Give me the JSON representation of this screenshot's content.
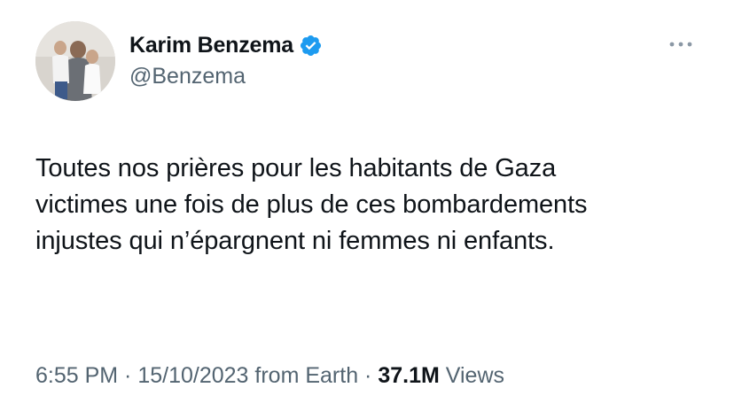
{
  "author": {
    "display_name": "Karim Benzema",
    "handle": "@Benzema",
    "verified": true,
    "avatar": "profile-photo"
  },
  "tweet": {
    "lines": [
      "Toutes nos prières pour les habitants de Gaza",
      "victimes une fois de plus de ces bombardements",
      "injustes qui n’épargnent ni femmes ni enfants."
    ]
  },
  "meta": {
    "time": "6:55 PM",
    "sep1": " · ",
    "date": "15/10/2023",
    "source": " from Earth",
    "sep2": " · ",
    "views_count": "37.1M",
    "views_label": " Views"
  },
  "icons": {
    "verified": "verified-badge-icon",
    "more": "more-options-icon"
  },
  "colors": {
    "text_primary": "#0f1419",
    "text_secondary": "#536471",
    "verified_blue": "#1d9bf0",
    "background": "#ffffff"
  }
}
